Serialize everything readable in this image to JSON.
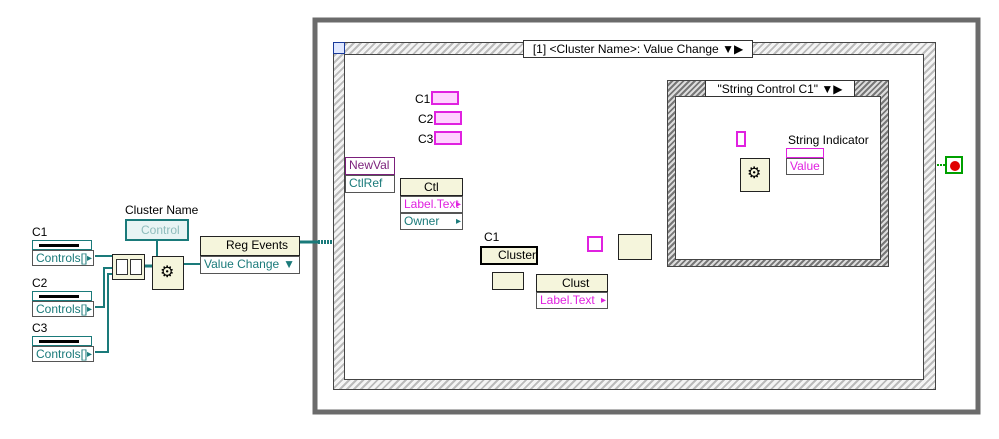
{
  "controls": {
    "c1_label": "C1",
    "c2_label": "C2",
    "c3_label": "C3",
    "controls_ref_label": "Controls[]"
  },
  "cluster_name": {
    "label": "Cluster Name",
    "control_text": "Control"
  },
  "reg_events": {
    "title": "Reg Events",
    "event": "Value Change"
  },
  "event_structure": {
    "selector": "[1] <Cluster Name>: Value Change",
    "newval": "NewVal",
    "ctlref": "CtlRef"
  },
  "constants": {
    "c1": "C1",
    "c2": "C2",
    "c3": "C3"
  },
  "ctl_node": {
    "title": "Ctl",
    "label_text": "Label.Text",
    "owner": "Owner"
  },
  "cluster_ref": {
    "label": "C1",
    "text": "Cluster"
  },
  "clust_node": {
    "title": "Clust",
    "label_text": "Label.Text"
  },
  "case_structure": {
    "selector": "\"String Control C1\"",
    "indicator_label": "String Indicator",
    "value": "Value"
  },
  "colors": {
    "frame": "#6b6b6b",
    "wire_teal": "#1a7a7a",
    "wire_purple": "#7b1f7b",
    "wire_pink": "#e021e0",
    "wire_green": "#00a000",
    "stop": "#e00000"
  }
}
